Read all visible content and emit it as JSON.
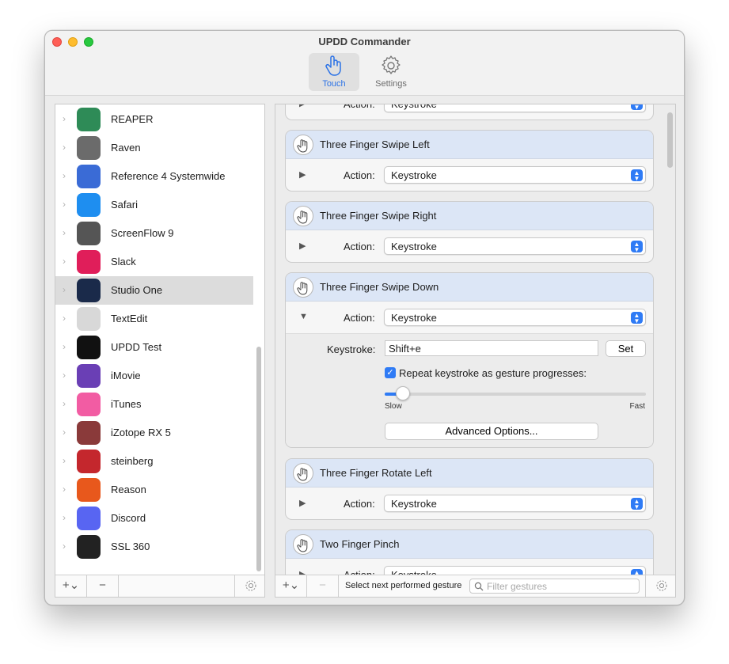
{
  "window": {
    "title": "UPDD Commander"
  },
  "toolbar": {
    "touch_label": "Touch",
    "settings_label": "Settings"
  },
  "apps": [
    {
      "name": "REAPER",
      "icon": "reaper-icon",
      "color": "#2e8b57"
    },
    {
      "name": "Raven",
      "icon": "raven-icon",
      "color": "#6b6b6b"
    },
    {
      "name": "Reference 4 Systemwide",
      "icon": "reference-icon",
      "color": "#3a6bd6"
    },
    {
      "name": "Safari",
      "icon": "safari-icon",
      "color": "#1e8ef0"
    },
    {
      "name": "ScreenFlow 9",
      "icon": "screenflow-icon",
      "color": "#555555"
    },
    {
      "name": "Slack",
      "icon": "slack-icon",
      "color": "#e01e5a"
    },
    {
      "name": "Studio One",
      "icon": "studio-one-icon",
      "color": "#1a2a4a"
    },
    {
      "name": "TextEdit",
      "icon": "textedit-icon",
      "color": "#d8d8d8"
    },
    {
      "name": "UPDD Test",
      "icon": "updd-test-icon",
      "color": "#111111"
    },
    {
      "name": "iMovie",
      "icon": "imovie-icon",
      "color": "#6a3fb5"
    },
    {
      "name": "iTunes",
      "icon": "itunes-icon",
      "color": "#f25ca3"
    },
    {
      "name": "iZotope RX 5",
      "icon": "izotope-icon",
      "color": "#8a3a3a"
    },
    {
      "name": "steinberg",
      "icon": "steinberg-icon",
      "color": "#c4272d"
    },
    {
      "name": "Reason",
      "icon": "reason-icon",
      "color": "#e8581c"
    },
    {
      "name": "Discord",
      "icon": "discord-icon",
      "color": "#5865f2"
    },
    {
      "name": "SSL 360",
      "icon": "ssl-icon",
      "color": "#222222"
    }
  ],
  "selected_app": "Studio One",
  "gestures": {
    "action_label": "Action:",
    "partial_top": {
      "action": "Keystroke"
    },
    "cards": [
      {
        "title": "Three Finger Swipe Left",
        "action": "Keystroke"
      },
      {
        "title": "Three Finger Swipe Right",
        "action": "Keystroke"
      },
      {
        "title": "Three Finger Swipe Down",
        "action": "Keystroke"
      },
      {
        "title": "Three Finger Rotate Left",
        "action": "Keystroke"
      },
      {
        "title": "Two Finger Pinch",
        "action": "Keystroke"
      }
    ],
    "expanded": {
      "keystroke_label": "Keystroke:",
      "keystroke_value": "Shift+e",
      "set_label": "Set",
      "repeat_label": "Repeat keystroke as gesture progresses:",
      "repeat_checked": true,
      "slow_label": "Slow",
      "fast_label": "Fast",
      "speed": 0.07,
      "advanced_label": "Advanced Options..."
    }
  },
  "bottom_bar": {
    "select_label": "Select next performed gesture",
    "filter_placeholder": "Filter gestures"
  },
  "colors": {
    "accent": "#2f7bf5",
    "header": "#dce6f6"
  }
}
